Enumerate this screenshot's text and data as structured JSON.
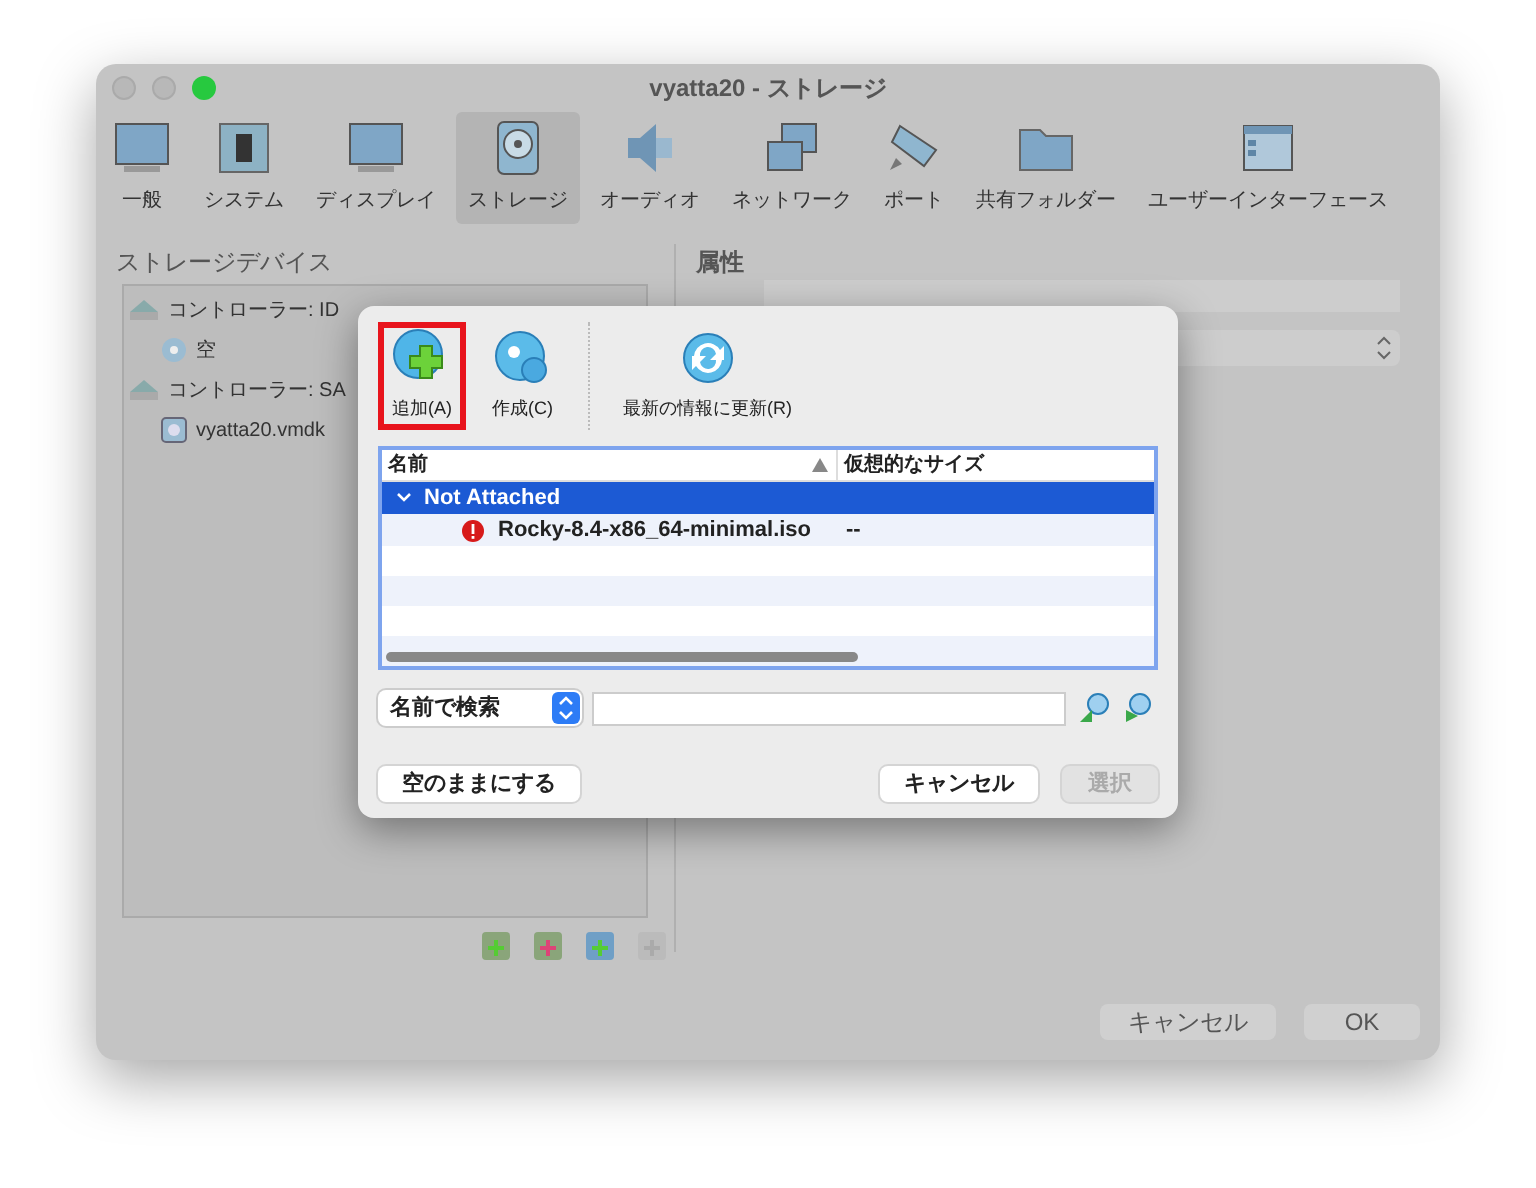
{
  "window": {
    "title": "vyatta20 - ストレージ"
  },
  "toolbar": [
    {
      "label": "一般",
      "kind": "monitor",
      "selected": false
    },
    {
      "label": "システム",
      "kind": "chip",
      "selected": false
    },
    {
      "label": "ディスプレイ",
      "kind": "monitor",
      "selected": false
    },
    {
      "label": "ストレージ",
      "kind": "disk",
      "selected": true
    },
    {
      "label": "オーディオ",
      "kind": "speaker",
      "selected": false
    },
    {
      "label": "ネットワーク",
      "kind": "network",
      "selected": false
    },
    {
      "label": "ポート",
      "kind": "plug",
      "selected": false
    },
    {
      "label": "共有フォルダー",
      "kind": "folder",
      "selected": false
    },
    {
      "label": "ユーザーインターフェース",
      "kind": "window",
      "selected": false
    }
  ],
  "storage_devices": {
    "title": "ストレージデバイス",
    "tree": [
      {
        "label": "コントローラー: ID",
        "kind": "controller",
        "children": [
          {
            "label": "空",
            "kind": "optical"
          }
        ]
      },
      {
        "label": "コントローラー: SA",
        "kind": "controller",
        "children": [
          {
            "label": "vyatta20.vmdk",
            "kind": "harddisk"
          }
        ]
      }
    ]
  },
  "attributes": {
    "title": "属性"
  },
  "buttons": [
    {
      "label": "キャンセル"
    },
    {
      "label": "OK"
    }
  ],
  "dialog": {
    "tools": [
      {
        "label": "追加(A)",
        "kind": "add",
        "highlighted": true
      },
      {
        "label": "作成(C)",
        "kind": "create",
        "highlighted": false
      },
      {
        "label": "最新の情報に更新(R)",
        "kind": "refresh",
        "highlighted": false
      }
    ],
    "columns": [
      "名前",
      "仮想的なサイズ"
    ],
    "rows": [
      {
        "kind": "group",
        "name": "Not Attached",
        "selected": true
      },
      {
        "kind": "item",
        "name": "Rocky-8.4-x86_64-minimal.iso",
        "size": "--",
        "selected": false
      }
    ],
    "search_mode": "名前で検索",
    "buttons": [
      {
        "label": "空のままにする",
        "disabled": false
      },
      {
        "label": "キャンセル",
        "disabled": false
      },
      {
        "label": "選択",
        "disabled": true
      }
    ]
  }
}
